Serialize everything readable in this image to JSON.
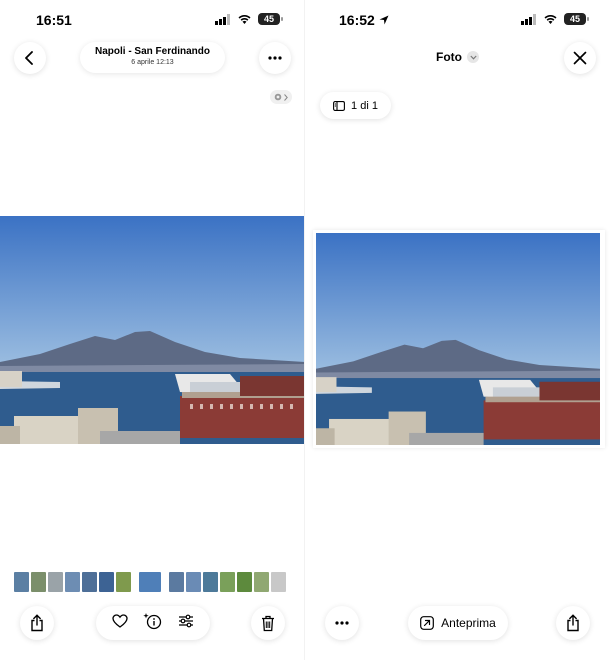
{
  "left_screen": {
    "status_bar": {
      "time": "16:51",
      "battery": "45"
    },
    "header": {
      "title": "Napoli - San Ferdinando",
      "subtitle": "6 aprile  12:13",
      "back_icon": "chevron-left-icon",
      "more_icon": "ellipsis-icon"
    },
    "info_badge": {
      "icon": "live-photo-icon"
    },
    "photo": {
      "description_icon": "landscape-photo"
    },
    "thumbnails": {
      "colors": [
        "#5b7fa3",
        "#7b8f6b",
        "#9aa3a8",
        "#6d8db3",
        "#4e6f98",
        "#3d6394",
        "#7f9a4d",
        "#4f7fb8",
        "#5b7aa0",
        "#6a8bb5",
        "#4d7a9a",
        "#7aa05a",
        "#5d8a3d",
        "#90a872",
        "#c8c8c8"
      ],
      "selected_index": 7
    },
    "toolbar": {
      "share_icon": "share-icon",
      "favorite_icon": "heart-icon",
      "info_icon": "info-sparkle-icon",
      "adjust_icon": "sliders-icon",
      "delete_icon": "trash-icon"
    }
  },
  "right_screen": {
    "status_bar": {
      "time": "16:52",
      "battery": "45"
    },
    "header": {
      "title": "Foto",
      "close_icon": "close-icon"
    },
    "page_indicator": {
      "label": "1 di 1"
    },
    "toolbar": {
      "more_icon": "ellipsis-icon",
      "preview_label": "Anteprima",
      "preview_icon": "arrow-up-right-icon",
      "share_icon": "share-icon"
    }
  },
  "colors": {
    "sky_top": "#3f77c9",
    "sky_bottom": "#8fb4dd",
    "sea": "#2f5c8e",
    "mountain": "#5d6a85",
    "building_red": "#8b3b36"
  }
}
